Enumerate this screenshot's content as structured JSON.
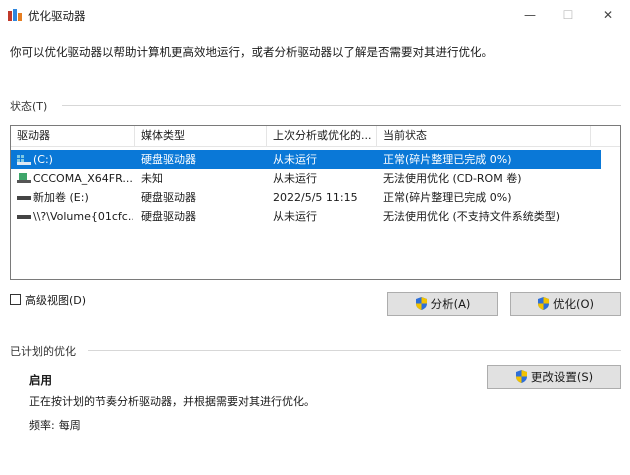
{
  "window": {
    "title": "优化驱动器",
    "minimize": "—",
    "maximize": "☐",
    "close": "✕"
  },
  "description": "你可以优化驱动器以帮助计算机更高效地运行，或者分析驱动器以了解是否需要对其进行优化。",
  "status": {
    "label": "状态(T)",
    "columns": [
      "驱动器",
      "媒体类型",
      "上次分析或优化的...",
      "当前状态"
    ],
    "rows": [
      {
        "drive": "(C:)",
        "media": "硬盘驱动器",
        "last": "从未运行",
        "state": "正常(碎片整理已完成 0%)",
        "icon": "drive-system-icon",
        "selected": true
      },
      {
        "drive": "CCCOMA_X64FR...",
        "media": "未知",
        "last": "从未运行",
        "state": "无法使用优化 (CD-ROM 卷)",
        "icon": "disc-drive-icon",
        "selected": false
      },
      {
        "drive": "新加卷 (E:)",
        "media": "硬盘驱动器",
        "last": "2022/5/5 11:15",
        "state": "正常(碎片整理已完成 0%)",
        "icon": "hard-drive-icon",
        "selected": false
      },
      {
        "drive": "\\\\?\\Volume{01cfc...",
        "media": "硬盘驱动器",
        "last": "从未运行",
        "state": "无法使用优化 (不支持文件系统类型)",
        "icon": "hard-drive-icon",
        "selected": false
      }
    ]
  },
  "advanced_view": {
    "label": "高级视图(D)",
    "checked": false
  },
  "buttons": {
    "analyze": "分析(A)",
    "optimize": "优化(O)",
    "change_settings": "更改设置(S)"
  },
  "schedule": {
    "label": "已计划的优化",
    "status": "启用",
    "description": "正在按计划的节奏分析驱动器，并根据需要对其进行优化。",
    "frequency_label": "频率:",
    "frequency_value": "每周"
  },
  "colors": {
    "selection": "#0a78d7",
    "button_bg": "#e1e1e1"
  }
}
